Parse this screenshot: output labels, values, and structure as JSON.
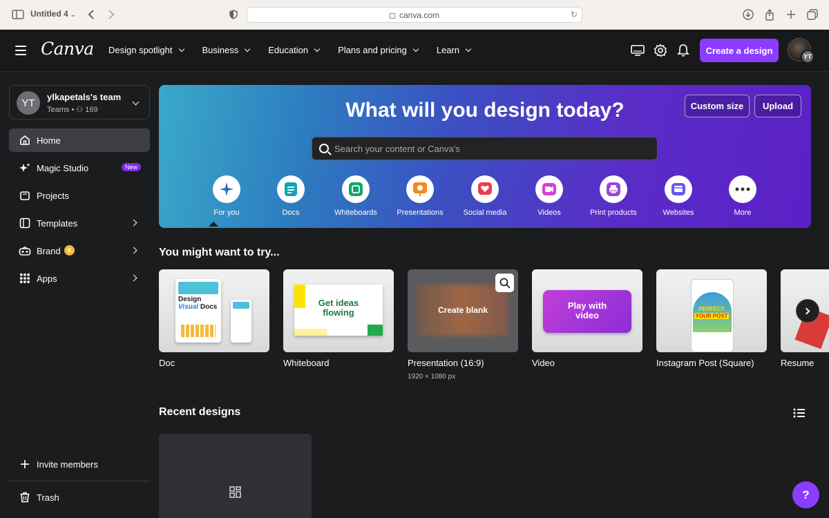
{
  "browser": {
    "tab_title": "Untitled 4",
    "url": "canva.com"
  },
  "nav": {
    "logo": "Canva",
    "menu": [
      {
        "label": "Design spotlight"
      },
      {
        "label": "Business"
      },
      {
        "label": "Education"
      },
      {
        "label": "Plans and pricing"
      },
      {
        "label": "Learn"
      }
    ],
    "create_label": "Create a design",
    "avatar_initials": "YT"
  },
  "sidebar": {
    "team_initials": "YT",
    "team_name": "ylkapetals's team",
    "team_sub": "Teams • ⚇ 169",
    "items": [
      {
        "label": "Home"
      },
      {
        "label": "Magic Studio",
        "badge": "New"
      },
      {
        "label": "Projects"
      },
      {
        "label": "Templates"
      },
      {
        "label": "Brand"
      },
      {
        "label": "Apps"
      }
    ],
    "invite_label": "Invite members",
    "trash_label": "Trash"
  },
  "hero": {
    "title": "What will you design today?",
    "custom_size": "Custom size",
    "upload": "Upload",
    "search_placeholder": "Search your content or Canva's",
    "categories": [
      {
        "label": "For you"
      },
      {
        "label": "Docs"
      },
      {
        "label": "Whiteboards"
      },
      {
        "label": "Presentations"
      },
      {
        "label": "Social media"
      },
      {
        "label": "Videos"
      },
      {
        "label": "Print products"
      },
      {
        "label": "Websites"
      },
      {
        "label": "More"
      }
    ]
  },
  "try": {
    "title": "You might want to try...",
    "cards": [
      {
        "label": "Doc",
        "thumb_text_1": "Design",
        "thumb_text_2": "Visual",
        "thumb_text_3": "Docs"
      },
      {
        "label": "Whiteboard",
        "thumb_text_1": "Get ideas",
        "thumb_text_2": "flowing"
      },
      {
        "label": "Presentation (16:9)",
        "sub": "1920 × 1080 px",
        "thumb_text_1": "Create blank"
      },
      {
        "label": "Video",
        "thumb_text_1": "Play with",
        "thumb_text_2": "video"
      },
      {
        "label": "Instagram Post (Square)",
        "thumb_text_1": "PERFECT",
        "thumb_text_2": "YOUR POST"
      },
      {
        "label": "Resume"
      }
    ]
  },
  "recent": {
    "title": "Recent designs"
  },
  "help_label": "?"
}
